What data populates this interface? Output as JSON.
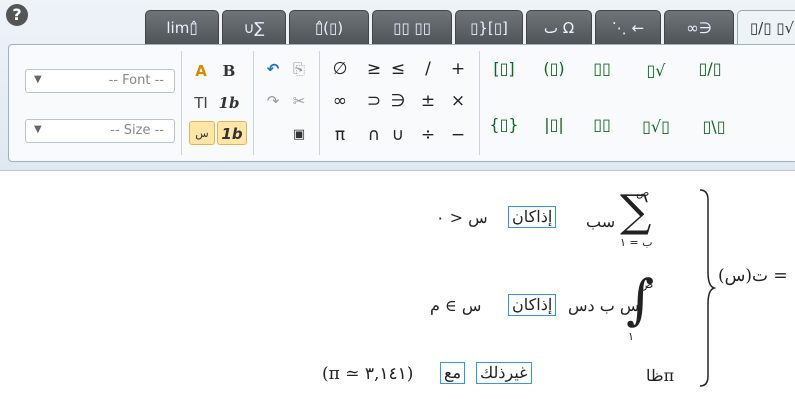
{
  "help_label": "?",
  "tabs": [
    "lim▯̂",
    "∪∑",
    "▯̂(▯)",
    "▯▯ ▯▯",
    "▯}[▯]",
    "ٮ Ω",
    "⋱ ←",
    "∞∋",
    "▯/▯ ▯√"
  ],
  "format": {
    "font_placeholder": "-- Font --",
    "size_placeholder": "-- Size --",
    "bold": "B",
    "textmode": "TI",
    "italic_num": "1b",
    "italic_num2": "1b",
    "sin_label": "س",
    "font_color": "A"
  },
  "edit": {
    "undo": "↶",
    "redo": "↷",
    "paste": "⎘",
    "cut": "✂",
    "special": "▣"
  },
  "symbols": [
    "∅",
    "≥",
    "≤",
    "/",
    "+",
    "∞",
    "⊃",
    "∋",
    "±",
    "×",
    "π",
    "∩",
    "∪",
    "÷",
    "−"
  ],
  "templates": [
    "[▯]",
    "(▯)",
    "▯▯",
    "{▯}",
    "|▯|",
    "▯▯",
    "▯√",
    "▯/▯",
    "▯√▯",
    "▯\\▯"
  ],
  "formula": {
    "lhs": "ت(س) =",
    "sum_top": "ص",
    "sum_bottom": "ب = ١",
    "sum_expr": "سب",
    "cond1_box": "إذاكان",
    "cond1_rest": "س < ٠",
    "int_top": "ص",
    "int_bottom": "١",
    "int_expr": "س ب دس",
    "cond2_box": "إذاكان",
    "cond2_rest": "س ∋ م",
    "tan": "ظاπ",
    "otherwise_box": "غيرذلك",
    "with_box": "مع",
    "pi_expr": "(π ≃ ٣,١٤١)"
  },
  "colors": {
    "accent": "#3399dd",
    "tab_dark": "#5a5f64",
    "template_green": "#116622"
  }
}
